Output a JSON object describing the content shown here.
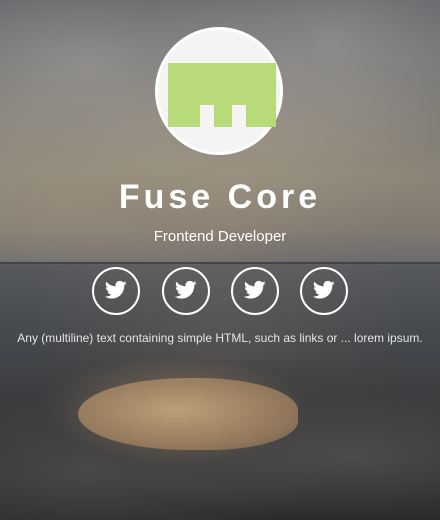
{
  "profile": {
    "name": "Fuse Core",
    "role": "Frontend Developer",
    "description": "Any (multiline) text containing simple HTML, such as links or ... lorem ipsum."
  },
  "logo": {
    "icon": "block-logo-icon",
    "color": "#b9da78"
  },
  "social_links": [
    {
      "icon": "twitter-icon"
    },
    {
      "icon": "twitter-icon"
    },
    {
      "icon": "twitter-icon"
    },
    {
      "icon": "twitter-icon"
    }
  ]
}
